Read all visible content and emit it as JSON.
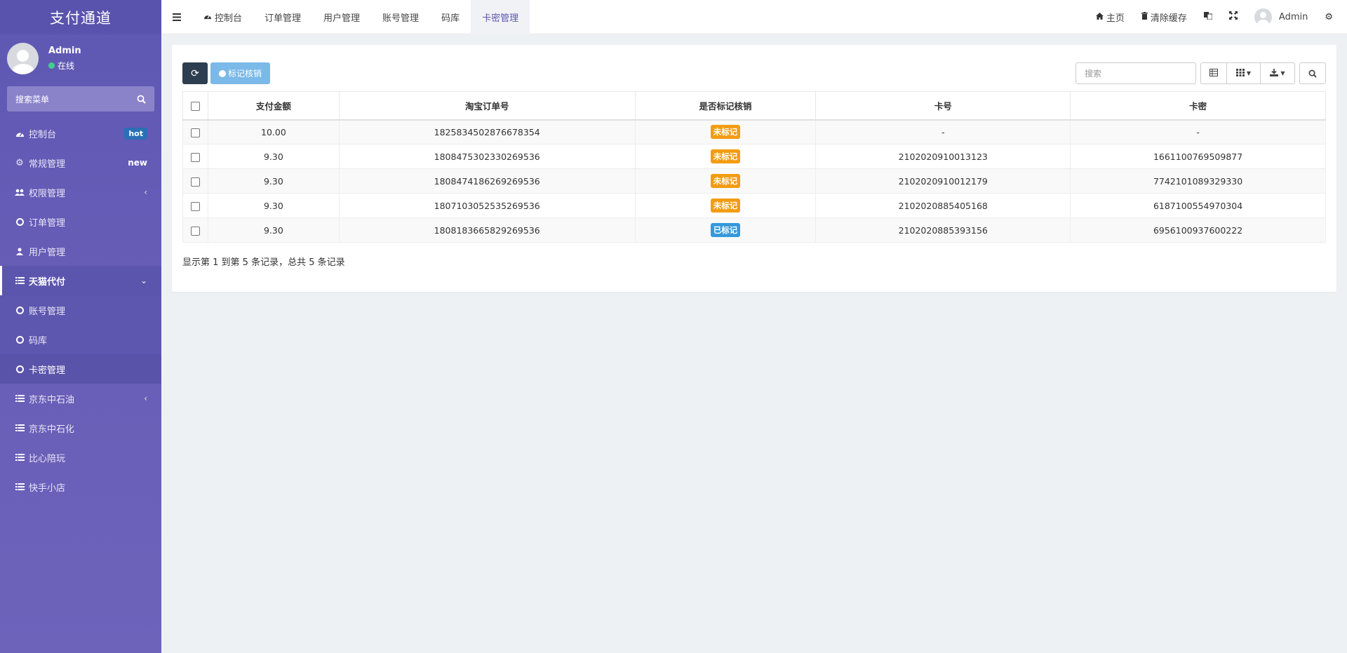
{
  "brand": "支付通道",
  "user": {
    "name": "Admin",
    "status": "在线"
  },
  "sidebar_search_placeholder": "搜索菜单",
  "menu": [
    {
      "label": "控制台",
      "badge": "hot",
      "icon": "dashboard-icon"
    },
    {
      "label": "常规管理",
      "badge": "new",
      "icon": "cogs-icon"
    },
    {
      "label": "权限管理",
      "icon": "users-icon",
      "chevron": "‹"
    },
    {
      "label": "订单管理",
      "icon": "circle-icon"
    },
    {
      "label": "用户管理",
      "icon": "user-icon"
    },
    {
      "label": "天猫代付",
      "icon": "list-icon",
      "chevron": "⌄"
    },
    {
      "label": "账号管理",
      "icon": "circle-icon"
    },
    {
      "label": "码库",
      "icon": "circle-icon"
    },
    {
      "label": "卡密管理",
      "icon": "circle-icon"
    },
    {
      "label": "京东中石油",
      "icon": "list-icon",
      "chevron": "‹"
    },
    {
      "label": "京东中石化",
      "icon": "list-icon"
    },
    {
      "label": "比心陪玩",
      "icon": "list-icon"
    },
    {
      "label": "快手小店",
      "icon": "list-icon"
    }
  ],
  "tabs": [
    {
      "label": "控制台",
      "icon": "dashboard-icon"
    },
    {
      "label": "订单管理"
    },
    {
      "label": "用户管理"
    },
    {
      "label": "账号管理"
    },
    {
      "label": "码库"
    },
    {
      "label": "卡密管理",
      "active": true
    }
  ],
  "topbar": {
    "home": "主页",
    "clear_cache": "清除缓存",
    "admin": "Admin"
  },
  "toolbar": {
    "mark_label": "标记核销",
    "search_placeholder": "搜索"
  },
  "table": {
    "headers": [
      "支付金额",
      "淘宝订单号",
      "是否标记核销",
      "卡号",
      "卡密"
    ],
    "rows": [
      [
        "10.00",
        "1825834502876678354",
        "未标记",
        "-",
        "-"
      ],
      [
        "9.30",
        "1808475302330269536",
        "未标记",
        "2102020910013123",
        "1661100769509877"
      ],
      [
        "9.30",
        "1808474186269269536",
        "未标记",
        "2102020910012179",
        "7742101089329330"
      ],
      [
        "9.30",
        "1807103052535269536",
        "未标记",
        "2102020885405168",
        "6187100554970304"
      ],
      [
        "9.30",
        "1808183665829269536",
        "已标记",
        "2102020885393156",
        "6956100937600222"
      ]
    ]
  },
  "pagination_info": "显示第 1 到第 5 条记录，总共 5 条记录",
  "colors": {
    "sidebar": "#5e58b3",
    "accent": "#5d56b1",
    "warning": "#f39c12",
    "info": "#3498db",
    "dark_button": "#2c3e50"
  }
}
